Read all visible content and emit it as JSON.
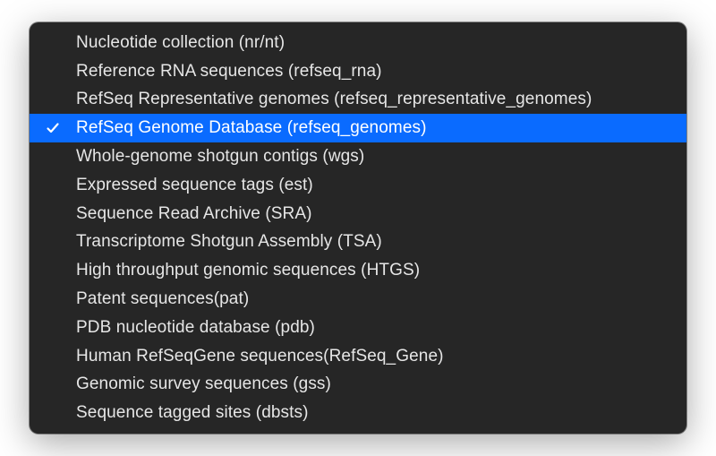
{
  "dropdown": {
    "selected_index": 3,
    "options": [
      {
        "label": "Nucleotide collection (nr/nt)"
      },
      {
        "label": "Reference RNA sequences (refseq_rna)"
      },
      {
        "label": "RefSeq Representative genomes (refseq_representative_genomes)"
      },
      {
        "label": "RefSeq Genome Database (refseq_genomes)"
      },
      {
        "label": "Whole-genome shotgun contigs (wgs)"
      },
      {
        "label": "Expressed sequence tags (est)"
      },
      {
        "label": "Sequence Read Archive (SRA)"
      },
      {
        "label": "Transcriptome Shotgun Assembly (TSA)"
      },
      {
        "label": "High throughput genomic sequences (HTGS)"
      },
      {
        "label": "Patent sequences(pat)"
      },
      {
        "label": "PDB nucleotide database (pdb)"
      },
      {
        "label": "Human RefSeqGene sequences(RefSeq_Gene)"
      },
      {
        "label": "Genomic survey sequences (gss)"
      },
      {
        "label": "Sequence tagged sites (dbsts)"
      }
    ]
  }
}
